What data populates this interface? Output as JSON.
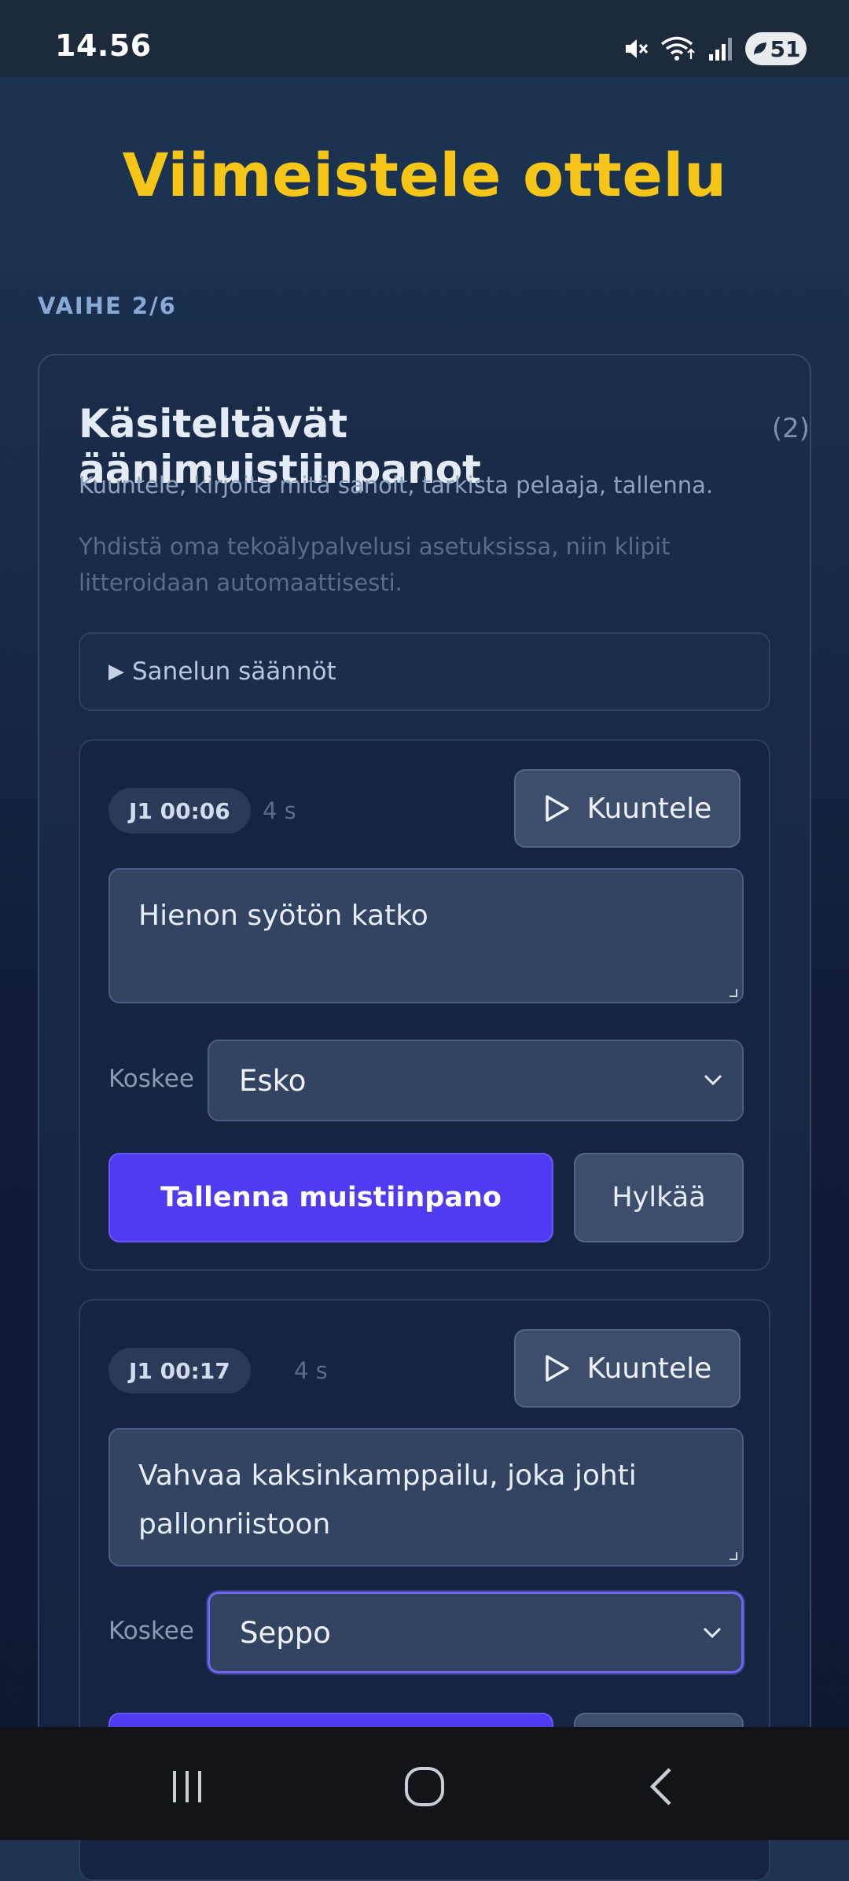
{
  "status_bar": {
    "time": "14.56",
    "battery": "51",
    "icons": [
      "mute-icon",
      "wifi-icon",
      "signal-icon",
      "battery-icon"
    ]
  },
  "header": {
    "title": "Viimeistele ottelu"
  },
  "step": {
    "label": "VAIHE 2/6"
  },
  "card": {
    "title": "Käsiteltävät äänimuistiinpanot",
    "count": "(2)",
    "description": "Kuuntele, kirjoita mitä sanoit, tarkista pelaaja, tallenna.",
    "hint": "Yhdistä oma tekoälypalvelusi asetuksissa, niin klipit litteroidaan automaattisesti.",
    "rules_label": "Sanelun säännöt"
  },
  "notes": [
    {
      "time": "J1 00:06",
      "duration": "4 s",
      "listen_label": "Kuuntele",
      "text": "Hienon syötön katko",
      "concerns_label": "Koskee",
      "player": "Esko",
      "save_label": "Tallenna muistiinpano",
      "reject_label": "Hylkää"
    },
    {
      "time": "J1 00:17",
      "duration": "4 s",
      "listen_label": "Kuuntele",
      "text": "Vahvaa kaksinkamppailu, joka johti pallonriistoon",
      "concerns_label": "Koskee",
      "player": "Seppo",
      "save_label": "",
      "reject_label": ""
    }
  ],
  "colors": {
    "accent": "#f5c518",
    "primary_button": "#4f3cf2",
    "focus": "#6e66f0"
  }
}
